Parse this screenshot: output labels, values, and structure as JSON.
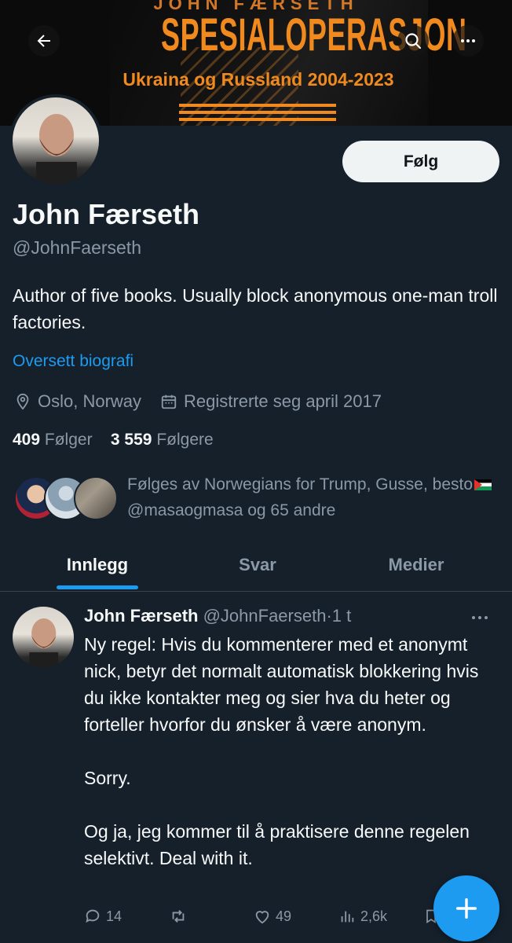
{
  "banner": {
    "top_text": "JOHN FÆRSETH",
    "title": "SPESIALOPERASJON",
    "subtitle": "Ukraina og Russland 2004-2023"
  },
  "header": {
    "back_icon": "arrow-left-icon",
    "search_icon": "search-icon",
    "more_icon": "more-horizontal-icon"
  },
  "profile": {
    "display_name": "John Færseth",
    "handle": "@JohnFaerseth",
    "bio": "Author of five books. Usually block anonymous one-man troll factories.",
    "translate_label": "Oversett biografi",
    "location": "Oslo, Norway",
    "joined": "Registrerte seg april 2017",
    "following_count": "409",
    "following_label": "Følger",
    "followers_count": "3 559",
    "followers_label": "Følgere",
    "follow_button": "Følg",
    "followed_by_prefix": "Følges av Norwegians for Trump, Gusse, besto",
    "followed_by_suffix": "@masaogmasa og 65 andre"
  },
  "tabs": [
    {
      "label": "Innlegg",
      "active": true
    },
    {
      "label": "Svar",
      "active": false
    },
    {
      "label": "Medier",
      "active": false
    }
  ],
  "post": {
    "author_name": "John Færseth",
    "author_handle": "@JohnFaerseth",
    "separator": "·",
    "time": "1 t",
    "paragraphs": [
      "Ny regel: Hvis du kommenterer med et anonymt nick, betyr det normalt automatisk blokkering hvis du ikke kontakter meg og sier hva du heter og forteller hvorfor du ønsker å være anonym.",
      "Sorry.",
      "Og ja, jeg kommer til å praktisere denne regelen selektivt. Deal with it."
    ],
    "replies": "14",
    "reposts": "",
    "likes": "49",
    "views": "2,6k"
  },
  "colors": {
    "background": "#15202b",
    "accent": "#1d9bf0",
    "secondary_text": "#8b98a5",
    "banner_orange": "#f08a1f"
  }
}
